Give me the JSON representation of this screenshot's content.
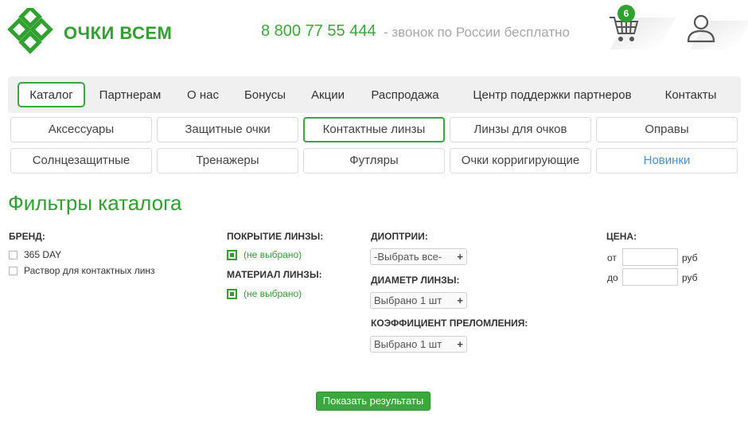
{
  "header": {
    "logo_text": "ОЧКИ ВСЕМ",
    "phone": "8 800 77 55 444",
    "phone_note": "- звонок по России бесплатно",
    "cart_count": "6",
    "logo_icon": "diamond-lattice-logo",
    "cart_icon": "cart-icon",
    "user_icon": "user-icon"
  },
  "nav": {
    "items": [
      {
        "label": "Каталог",
        "active": true
      },
      {
        "label": "Партнерам"
      },
      {
        "label": "О нас"
      },
      {
        "label": "Бонусы"
      },
      {
        "label": "Акции"
      },
      {
        "label": "Распродажа"
      },
      {
        "label": "Центр поддержки партнеров"
      },
      {
        "label": "Контакты"
      }
    ]
  },
  "categories": {
    "row1": [
      "Аксессуары",
      "Защитные очки",
      "Контактные линзы",
      "Линзы для очков",
      "Оправы"
    ],
    "row2": [
      "Солнцезащитные",
      "Тренажеры",
      "Футляры",
      "Очки корригирующие",
      "Новинки"
    ],
    "active": "Контактные линзы"
  },
  "page_title": "Фильтры каталога",
  "filters": {
    "brand": {
      "label": "БРЕНД:",
      "options": [
        "365 DAY",
        "Раствор для контактных линз"
      ]
    },
    "coating": {
      "label": "ПОКРЫТИЕ ЛИНЗЫ:",
      "value": "(не выбрано)"
    },
    "material": {
      "label": "МАТЕРИАЛ ЛИНЗЫ:",
      "value": "(не выбрано)"
    },
    "diopters": {
      "label": "ДИОПТРИИ:",
      "value": "-Выбрать все-"
    },
    "diameter": {
      "label": "ДИАМЕТР ЛИНЗЫ:",
      "value": "Выбрано 1 шт"
    },
    "refraction": {
      "label": "КОЭФФИЦИЕНТ ПРЕЛОМЛЕНИЯ:",
      "value": "Выбрано 1 шт"
    },
    "price": {
      "label": "ЦЕНА:",
      "from_label": "от",
      "to_label": "до",
      "currency": "руб",
      "from_value": "",
      "to_value": ""
    }
  },
  "submit_label": "Показать результаты",
  "colors": {
    "brand_green": "#2ea12e",
    "link_blue": "#4a90d9"
  }
}
